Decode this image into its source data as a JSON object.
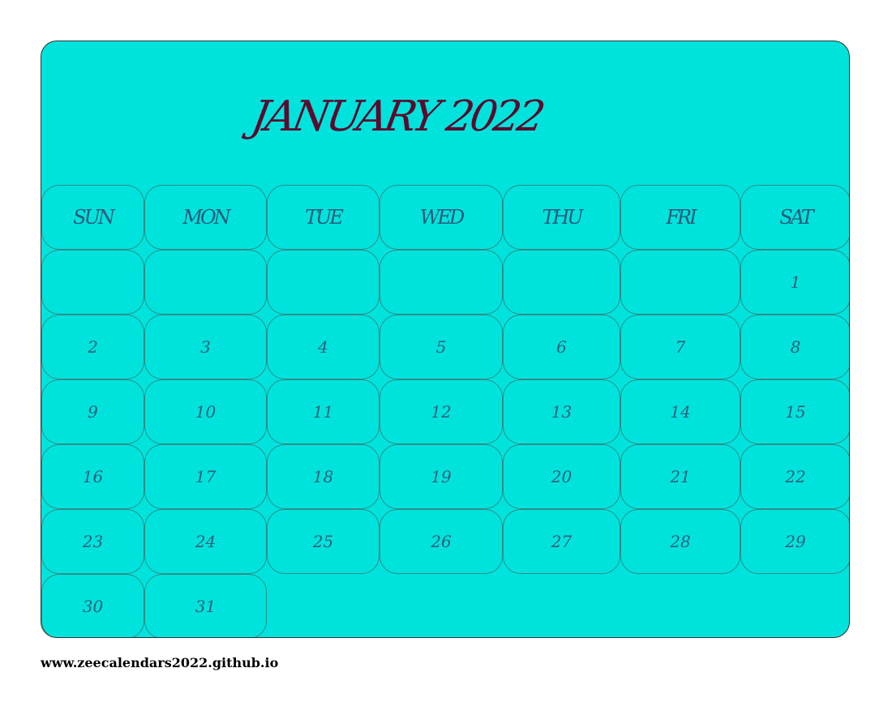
{
  "calendar": {
    "title": "JANUARY 2022",
    "weekdays": [
      "SUN",
      "MON",
      "TUE",
      "WED",
      "THU",
      "FRI",
      "SAT"
    ],
    "weeks": [
      [
        "",
        "",
        "",
        "",
        "",
        "",
        "1"
      ],
      [
        "2",
        "3",
        "4",
        "5",
        "6",
        "7",
        "8"
      ],
      [
        "9",
        "10",
        "11",
        "12",
        "13",
        "14",
        "15"
      ],
      [
        "16",
        "17",
        "18",
        "19",
        "20",
        "21",
        "22"
      ],
      [
        "23",
        "24",
        "25",
        "26",
        "27",
        "28",
        "29"
      ],
      [
        "30",
        "31"
      ]
    ]
  },
  "footer": {
    "url": "www.zeecalendars2022.github.io"
  },
  "colors": {
    "background": "#00e3dc",
    "title": "#5a0a2e",
    "cell_border": "#2f8d88",
    "text": "#2a5a7a"
  }
}
